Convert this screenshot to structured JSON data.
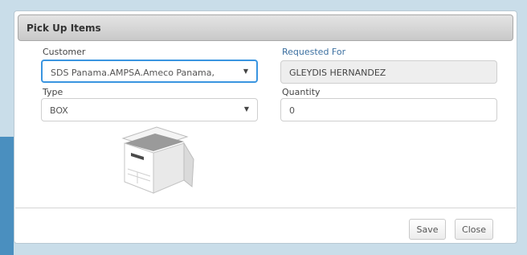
{
  "dialog": {
    "title": "Pick Up Items",
    "customer": {
      "label": "Customer",
      "value": "SDS Panama.AMPSA.Ameco Panama,"
    },
    "requested_for": {
      "label": "Requested For",
      "value": "GLEYDIS HERNANDEZ"
    },
    "type": {
      "label": "Type",
      "value": "BOX"
    },
    "quantity": {
      "label": "Quantity",
      "value": "0"
    },
    "buttons": {
      "save": "Save",
      "close": "Close"
    },
    "image": "storage-box-icon"
  },
  "colors": {
    "background": "#c9dde9",
    "accent_bar": "#4a8fbf",
    "label_blue": "#3b6fa0",
    "focus_border": "#3a95e0"
  }
}
